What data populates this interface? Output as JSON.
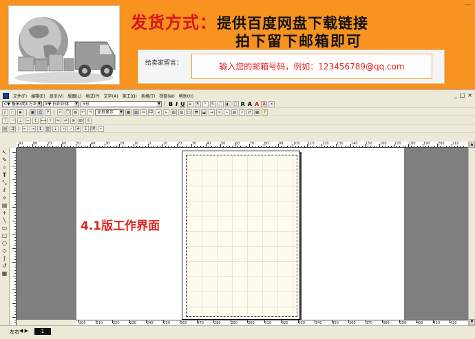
{
  "banner": {
    "headline_red": "发货方式：",
    "headline_rest": "提供百度网盘下载链接",
    "subline": "拍下留下邮箱即可",
    "message_label": "给卖家留言：",
    "message_input_text": "输入您的邮箱号码，例如：123456789@qq.com",
    "corner_mark": "—"
  },
  "menubar": {
    "items": [
      "文件(F)",
      "编辑(E)",
      "显示(V)",
      "版面(L)",
      "格式(P)",
      "文字(A)",
      "美工(D)",
      "表格(T)",
      "视窗(W)",
      "帮助(H)"
    ],
    "window_buttons": [
      "_",
      "□",
      "×"
    ]
  },
  "toolbar1": {
    "font_combo": "C▼ 报宋(简)(方正)",
    "font_combo2": "E▼ 白正正体",
    "size_combo": "5号",
    "format_buttons": [
      "B",
      "I",
      "U",
      "R",
      "A",
      "A",
      "A"
    ]
  },
  "toolbar2": {
    "page_view_combo": "全页显示"
  },
  "left_tools": [
    "↖",
    "✎",
    "⌕",
    "T",
    "⤡",
    "ℓ",
    "⟡",
    "▤",
    "+",
    "╲",
    "▭",
    "▢",
    "○",
    "◇",
    "∫",
    "↺",
    "▦"
  ],
  "workspace": {
    "overlay_label": "4.1版工作界面",
    "colors": {
      "gutter": "#7f7f7f",
      "grid_bg": "#fdfcee",
      "overlay": "#e0241f"
    }
  },
  "statusbar": {
    "page_tab_label": "左右",
    "page_nav": "◀ ▶",
    "page_number": "1"
  },
  "ruler": {
    "top_labels": [
      "90",
      "80",
      "70",
      "60",
      "50",
      "40",
      "30",
      "20",
      "10",
      "0",
      "10",
      "20",
      "30",
      "40",
      "50",
      "60",
      "70",
      "80",
      "90",
      "100",
      "110",
      "120",
      "130",
      "140",
      "150",
      "160",
      "170",
      "180",
      "190",
      "200",
      "210"
    ],
    "bottom_labels": [
      "200",
      "210",
      "220",
      "230",
      "240",
      "250",
      "260",
      "270",
      "280",
      "290",
      "300",
      "310",
      "320",
      "330",
      "340",
      "350",
      "360",
      "370",
      "380",
      "390",
      "400",
      "410",
      "420"
    ]
  }
}
